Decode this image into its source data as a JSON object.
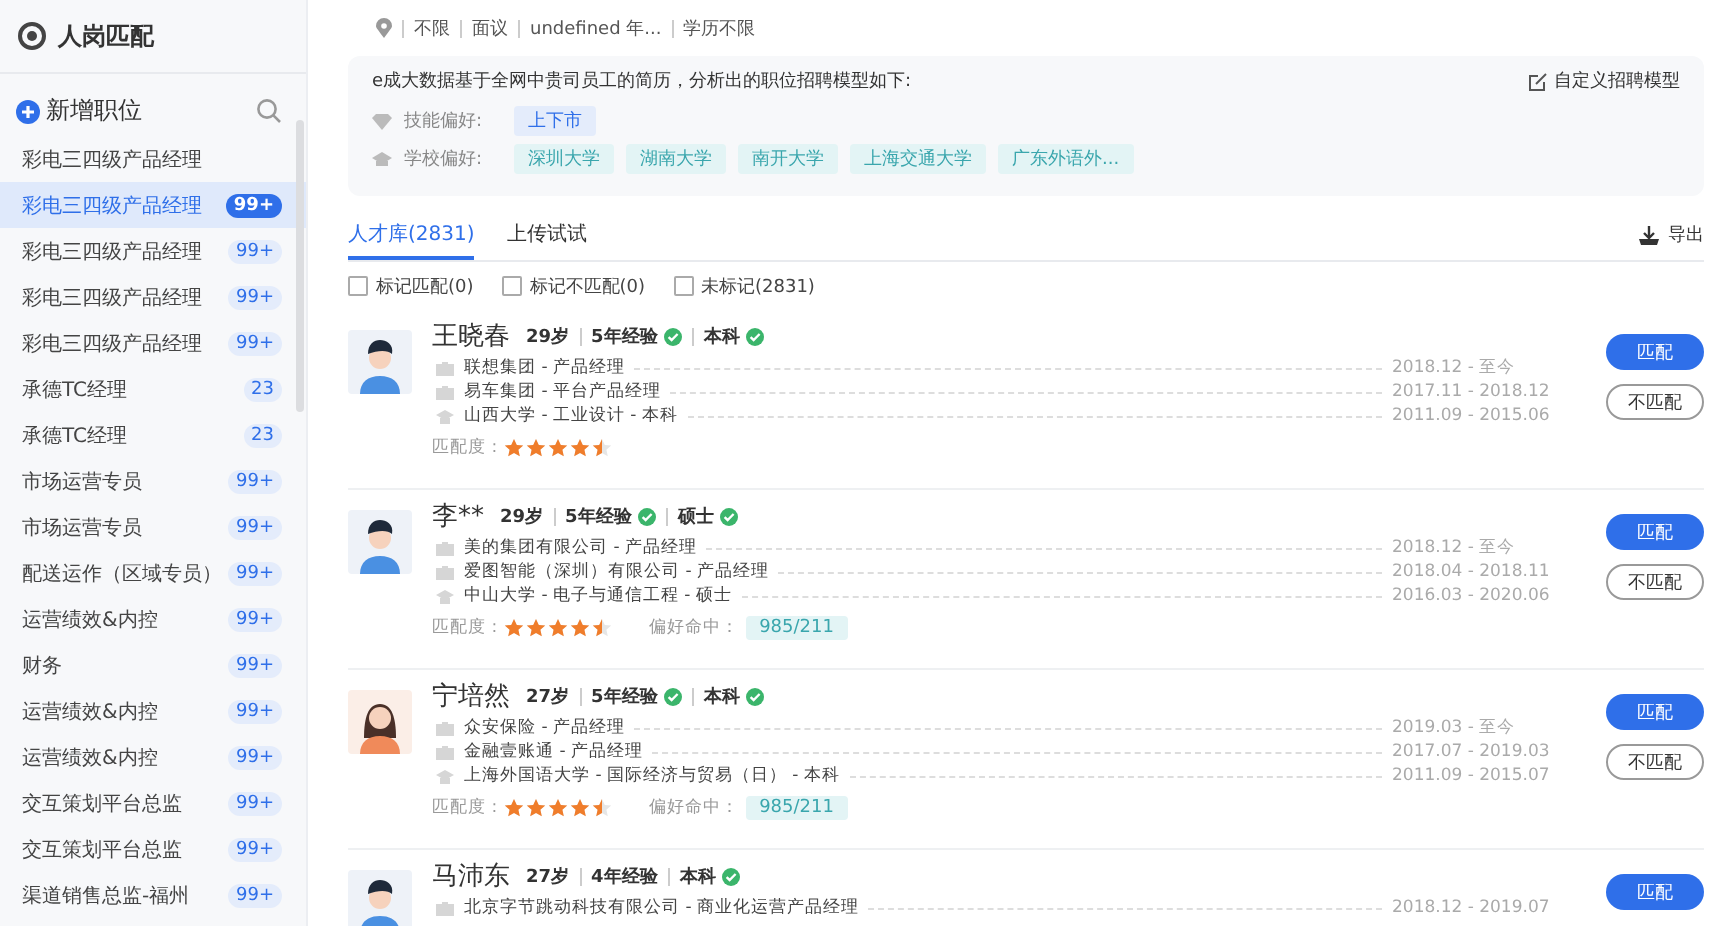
{
  "sidebar": {
    "title": "人岗匹配",
    "add_label": "新增职位",
    "items": [
      {
        "label": "彩电三四级产品经理",
        "selected": false
      },
      {
        "label": "彩电三四级产品经理",
        "count": "99+",
        "selected": true
      },
      {
        "label": "彩电三四级产品经理",
        "count": "99+",
        "selected": false
      },
      {
        "label": "彩电三四级产品经理",
        "count": "99+",
        "selected": false
      },
      {
        "label": "彩电三四级产品经理",
        "count": "99+",
        "selected": false
      },
      {
        "label": "承德TC经理",
        "count": "23",
        "selected": false
      },
      {
        "label": "承德TC经理",
        "count": "23",
        "selected": false
      },
      {
        "label": "市场运营专员",
        "count": "99+",
        "selected": false
      },
      {
        "label": "市场运营专员",
        "count": "99+",
        "selected": false
      },
      {
        "label": "配送运作（区域专员）",
        "count": "99+",
        "selected": false
      },
      {
        "label": "运营绩效&内控",
        "count": "99+",
        "selected": false
      },
      {
        "label": "财务",
        "count": "99+",
        "selected": false
      },
      {
        "label": "运营绩效&内控",
        "count": "99+",
        "selected": false
      },
      {
        "label": "运营绩效&内控",
        "count": "99+",
        "selected": false
      },
      {
        "label": "交互策划平台总监",
        "count": "99+",
        "selected": false
      },
      {
        "label": "交互策划平台总监",
        "count": "99+",
        "selected": false
      },
      {
        "label": "渠道销售总监-福州",
        "count": "99+",
        "selected": false
      }
    ]
  },
  "job_meta": [
    "不限",
    "面议",
    "undefined 年...",
    "学历不限"
  ],
  "model": {
    "intro": "e成大数据基于全网中贵司员工的简历，分析出的职位招聘模型如下:",
    "action": "自定义招聘模型",
    "groups": [
      {
        "kind": "skill",
        "label": "技能偏好:",
        "tags": [
          "上下市"
        ]
      },
      {
        "kind": "school",
        "label": "学校偏好:",
        "tags": [
          "深圳大学",
          "湖南大学",
          "南开大学",
          "上海交通大学",
          "广东外语外..."
        ]
      }
    ]
  },
  "tabs": [
    {
      "label": "人才库(2831)",
      "selected": true
    },
    {
      "label": "上传试试",
      "selected": false
    }
  ],
  "export_label": "导出",
  "filters": [
    {
      "label": "标记匹配(0)",
      "checked": false
    },
    {
      "label": "标记不匹配(0)",
      "checked": false
    },
    {
      "label": "未标记(2831)",
      "checked": false
    }
  ],
  "candidates": [
    {
      "kind": "male",
      "name": "王晓春",
      "age": "29岁",
      "tags": [
        {
          "label": "5年经验",
          "verified": true
        },
        {
          "label": "本科",
          "verified": true
        }
      ],
      "history": [
        {
          "kind": "work",
          "text": "联想集团 - 产品经理",
          "period": "2018.12 - 至今"
        },
        {
          "kind": "work",
          "text": "易车集团 - 平台产品经理",
          "period": "2017.11 - 2018.12"
        },
        {
          "kind": "school",
          "text": "山西大学 - 工业设计 - 本科",
          "period": "2011.09 - 2015.06"
        }
      ],
      "match_label": "匹配度 :",
      "stars": 4.5,
      "buttons": [
        {
          "kind": "primary",
          "label": "匹配"
        },
        {
          "kind": "outline",
          "label": "不匹配"
        }
      ]
    },
    {
      "kind": "male",
      "name": "李**",
      "age": "29岁",
      "tags": [
        {
          "label": "5年经验",
          "verified": true
        },
        {
          "label": "硕士",
          "verified": true
        }
      ],
      "history": [
        {
          "kind": "work",
          "text": "美的集团有限公司 - 产品经理",
          "period": "2018.12 - 至今"
        },
        {
          "kind": "work",
          "text": "爱图智能（深圳）有限公司 - 产品经理",
          "period": "2018.04 - 2018.11"
        },
        {
          "kind": "school",
          "text": "中山大学 - 电子与通信工程 - 硕士",
          "period": "2016.03 - 2020.06"
        }
      ],
      "match_label": "匹配度 :",
      "stars": 4.5,
      "preference": {
        "label": "偏好命中：",
        "tag": "985/211"
      },
      "buttons": [
        {
          "kind": "primary",
          "label": "匹配"
        },
        {
          "kind": "outline",
          "label": "不匹配"
        }
      ]
    },
    {
      "kind": "female",
      "name": "宁培然",
      "age": "27岁",
      "tags": [
        {
          "label": "5年经验",
          "verified": true
        },
        {
          "label": "本科",
          "verified": true
        }
      ],
      "history": [
        {
          "kind": "work",
          "text": "众安保险 - 产品经理",
          "period": "2019.03 - 至今"
        },
        {
          "kind": "work",
          "text": "金融壹账通 - 产品经理",
          "period": "2017.07 - 2019.03"
        },
        {
          "kind": "school",
          "text": "上海外国语大学 - 国际经济与贸易（日） - 本科",
          "period": "2011.09 - 2015.07"
        }
      ],
      "match_label": "匹配度 :",
      "stars": 4.5,
      "preference": {
        "label": "偏好命中：",
        "tag": "985/211"
      },
      "buttons": [
        {
          "kind": "primary",
          "label": "匹配"
        },
        {
          "kind": "outline",
          "label": "不匹配"
        }
      ]
    },
    {
      "kind": "male",
      "name": "马沛东",
      "age": "27岁",
      "tags": [
        {
          "label": "4年经验",
          "verified": false
        },
        {
          "label": "本科",
          "verified": true
        }
      ],
      "history": [
        {
          "kind": "work",
          "text": "北京字节跳动科技有限公司 - 商业化运营产品经理",
          "period": "2018.12 - 2019.07"
        }
      ],
      "buttons": [
        {
          "kind": "primary",
          "label": "匹配"
        }
      ]
    }
  ]
}
